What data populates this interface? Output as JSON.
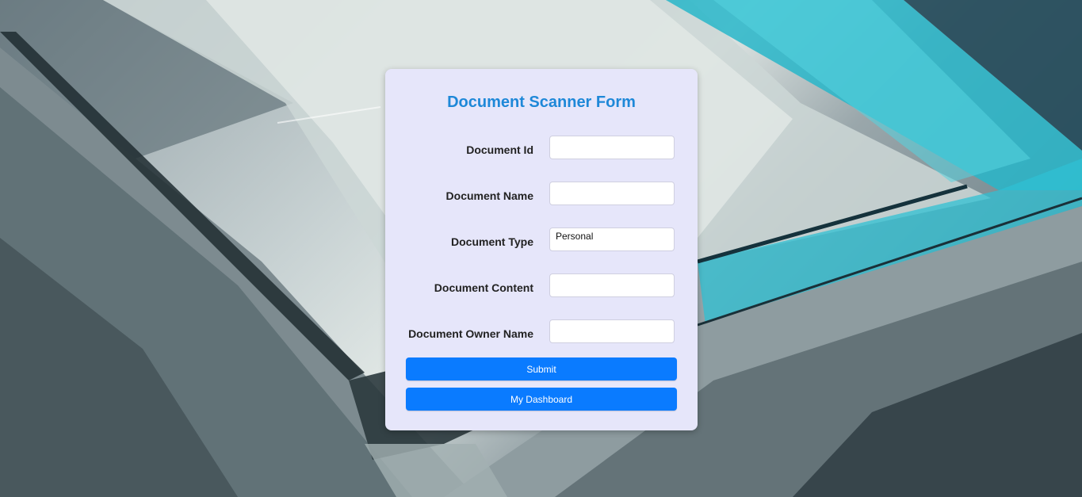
{
  "form": {
    "title": "Document Scanner Form",
    "fields": [
      {
        "label": "Document Id",
        "value": ""
      },
      {
        "label": "Document Name",
        "value": ""
      },
      {
        "label": "Document Type",
        "value": "Personal"
      },
      {
        "label": "Document Content",
        "value": ""
      },
      {
        "label": "Document Owner Name",
        "value": ""
      }
    ],
    "submit_label": "Submit",
    "dashboard_label": "My Dashboard"
  },
  "colors": {
    "title": "#1e88d8",
    "button": "#0a7bff",
    "card": "#e6e6fa"
  }
}
